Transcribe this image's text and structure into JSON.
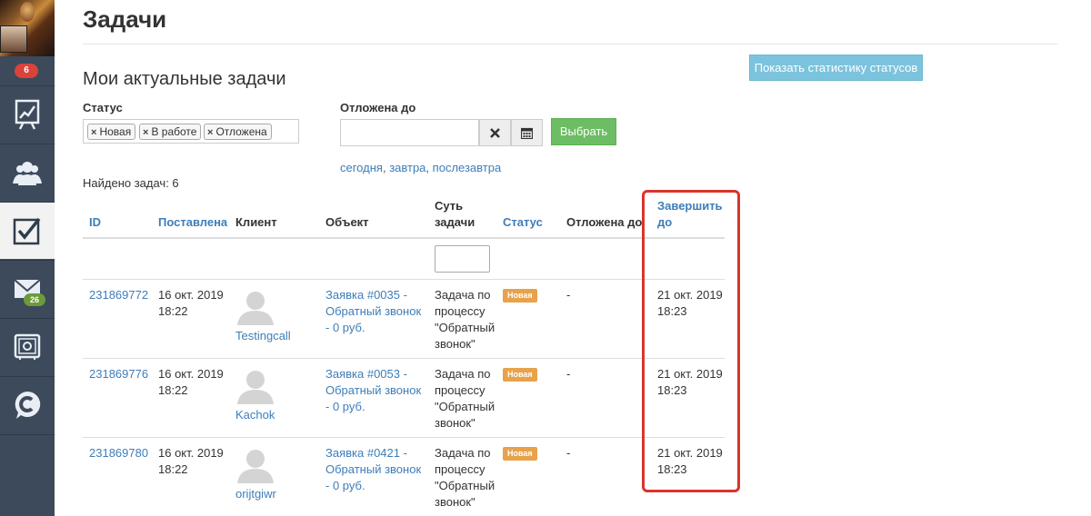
{
  "sidebar": {
    "notifications_badge": "6",
    "mail_badge": "26",
    "items": [
      {
        "icon": "chart-board-icon"
      },
      {
        "icon": "users-group-icon"
      },
      {
        "icon": "checkbox-tasks-icon",
        "active": true
      },
      {
        "icon": "mail-envelope-icon"
      },
      {
        "icon": "safe-settings-icon"
      },
      {
        "icon": "chat-c-icon"
      }
    ]
  },
  "page": {
    "title": "Задачи",
    "section_title": "Мои актуальные задачи",
    "stats_button": "Показать статистику статусов"
  },
  "filters": {
    "status_label": "Статус",
    "status_chips": [
      "Новая",
      "В работе",
      "Отложена"
    ],
    "chip_remove": "×",
    "postponed_label": "Отложена до",
    "postponed_value": "",
    "choose_button": "Выбрать",
    "quick_today": "сегодня",
    "quick_tomorrow": "завтра",
    "quick_after": "послезавтра",
    "comma": ","
  },
  "found_text": "Найдено задач: 6",
  "table": {
    "headers": {
      "id": "ID",
      "created": "Поставлена",
      "client": "Клиент",
      "object": "Объект",
      "essence_1": "Суть",
      "essence_2": "задачи",
      "status": "Статус",
      "postponed": "Отложена до",
      "due_1": "Завершить",
      "due_2": "до"
    },
    "filter_value": "",
    "rows": [
      {
        "id": "231869772",
        "created_date": "16 окт. 2019",
        "created_time": "18:22",
        "client": "Testingcall",
        "object_1": "Заявка #0035 -",
        "object_2": "Обратный звонок",
        "object_3": "- 0 руб.",
        "essence_1": "Задача по",
        "essence_2": "процессу",
        "essence_3": "\"Обратный",
        "essence_4": "звонок\"",
        "status": "Новая",
        "postponed": "-",
        "due_date": "21 окт. 2019",
        "due_time": "18:23"
      },
      {
        "id": "231869776",
        "created_date": "16 окт. 2019",
        "created_time": "18:22",
        "client": "Kachok",
        "object_1": "Заявка #0053 -",
        "object_2": "Обратный звонок",
        "object_3": "- 0 руб.",
        "essence_1": "Задача по",
        "essence_2": "процессу",
        "essence_3": "\"Обратный",
        "essence_4": "звонок\"",
        "status": "Новая",
        "postponed": "-",
        "due_date": "21 окт. 2019",
        "due_time": "18:23"
      },
      {
        "id": "231869780",
        "created_date": "16 окт. 2019",
        "created_time": "18:22",
        "client": "orijtgiwr",
        "object_1": "Заявка #0421 -",
        "object_2": "Обратный звонок",
        "object_3": "- 0 руб.",
        "essence_1": "Задача по",
        "essence_2": "процессу",
        "essence_3": "\"Обратный",
        "essence_4": "звонок\"",
        "status": "Новая",
        "postponed": "-",
        "due_date": "21 окт. 2019",
        "due_time": "18:23"
      }
    ]
  },
  "colors": {
    "sidebar_bg": "#3c4a5c",
    "link": "#3d7eb8",
    "status_new": "#e7a24a",
    "choose_button": "#6cbd63",
    "stats_button": "#7cc3dd",
    "highlight": "#d9342b"
  }
}
